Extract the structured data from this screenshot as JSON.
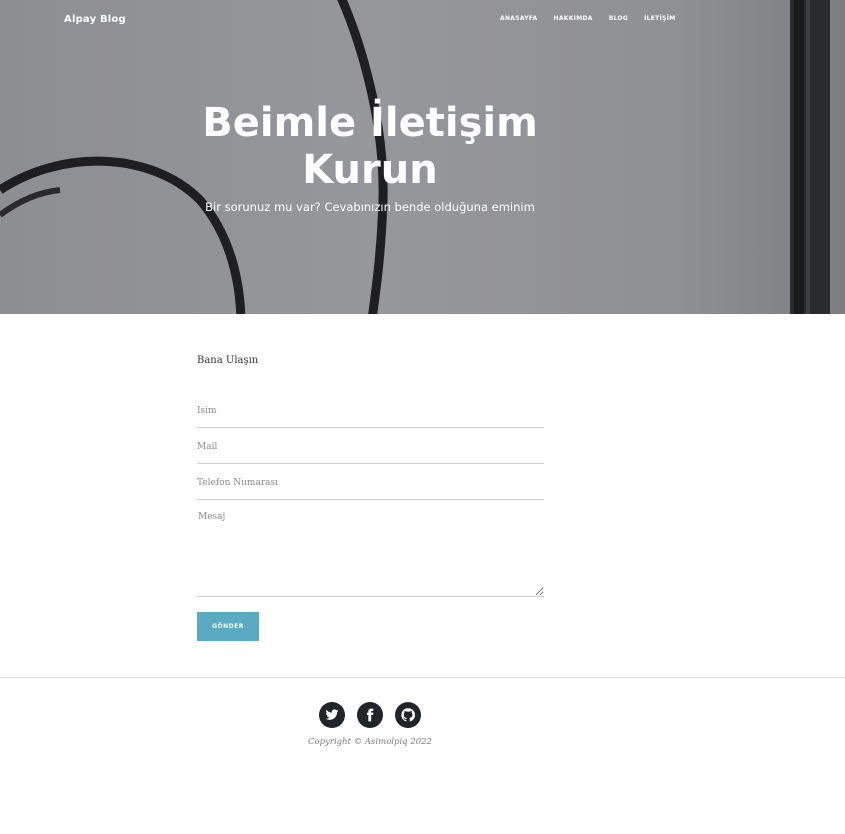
{
  "nav": {
    "brand": "Alpay Blog",
    "links": [
      "ANASAYFA",
      "HAKKIMDA",
      "BLOG",
      "İLETİŞİM"
    ]
  },
  "hero": {
    "title_line1": "Beimle İletişim",
    "title_line2": "Kurun",
    "subtitle": "Bir sorunuz mu var? Cevabınızın bende olduğuna eminim"
  },
  "form": {
    "intro": "Bana Ulaşın",
    "name_placeholder": "İsim",
    "mail_placeholder": "Mail",
    "phone_placeholder": "Telefon Numarası",
    "message_placeholder": "Mesaj",
    "submit_label": "GÖNDER"
  },
  "footer": {
    "social_icons": [
      "twitter-icon",
      "facebook-icon",
      "github-icon"
    ],
    "copyright": "Copyright © Asimolpiq 2022"
  },
  "colors": {
    "accent": "#5aaac4",
    "footer_icon_bg": "#212529",
    "hero_overlay": "#8d8e92"
  }
}
